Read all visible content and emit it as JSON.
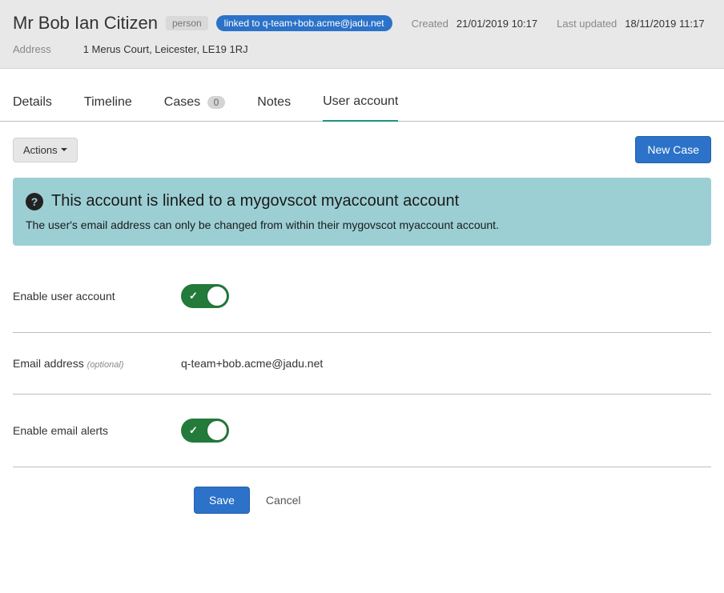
{
  "header": {
    "name": "Mr Bob Ian Citizen",
    "person_tag": "person",
    "linked_tag": "linked to q-team+bob.acme@jadu.net",
    "created_label": "Created",
    "created_value": "21/01/2019 10:17",
    "updated_label": "Last updated",
    "updated_value": "18/11/2019 11:17",
    "address_label": "Address",
    "address_value": "1 Merus Court, Leicester, LE19 1RJ"
  },
  "tabs": {
    "details": "Details",
    "timeline": "Timeline",
    "cases": "Cases",
    "cases_count": "0",
    "notes": "Notes",
    "user_account": "User account"
  },
  "actions": {
    "actions_label": "Actions",
    "new_case": "New Case"
  },
  "alert": {
    "title": "This account is linked to a mygovscot myaccount account",
    "text": "The user's email address can only be changed from within their mygovscot myaccount account."
  },
  "form": {
    "enable_account_label": "Enable user account",
    "email_label": "Email address",
    "optional": "(optional)",
    "email_value": "q-team+bob.acme@jadu.net",
    "enable_alerts_label": "Enable email alerts"
  },
  "buttons": {
    "save": "Save",
    "cancel": "Cancel"
  }
}
